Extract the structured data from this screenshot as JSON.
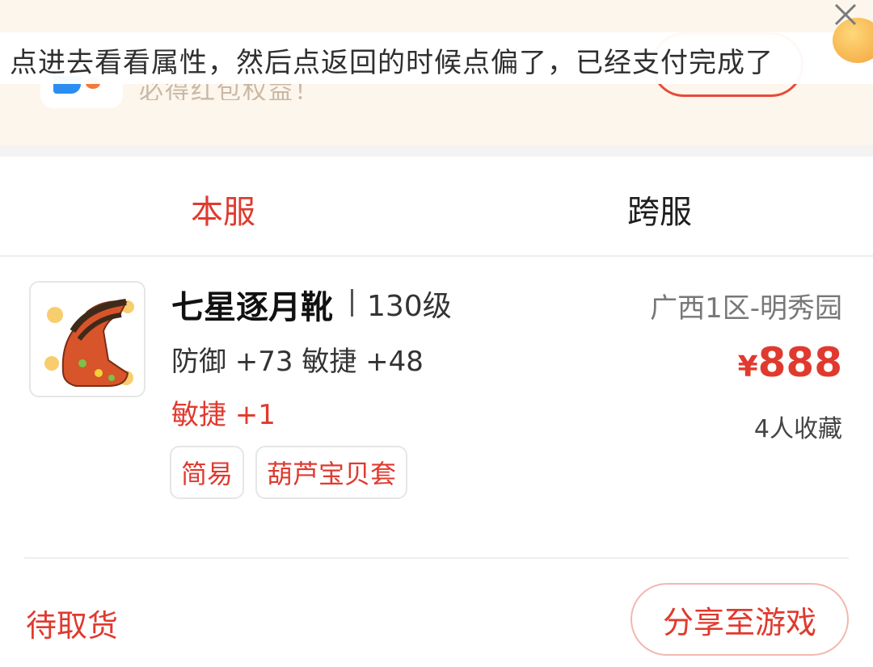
{
  "banner": {
    "text": "必得红包权益！"
  },
  "overlay": {
    "comment": "点进去看看属性，然后点返回的时候点偏了，已经支付完成了"
  },
  "tabs": [
    {
      "label": "本服",
      "active": true
    },
    {
      "label": "跨服",
      "active": false
    }
  ],
  "item": {
    "name": "七星逐月靴",
    "level": "130级",
    "server": "广西1区-明秀园",
    "stats": "防御 +73 敏捷 +48",
    "extra_stat": "敏捷 +1",
    "price_symbol": "¥",
    "price": "888",
    "favorites": "4人收藏",
    "tags": [
      "简易",
      "葫芦宝贝套"
    ]
  },
  "footer": {
    "status": "待取货",
    "share_button": "分享至游戏"
  },
  "colors": {
    "accent": "#e03a2f",
    "banner_bg": "#fdf6ec"
  }
}
